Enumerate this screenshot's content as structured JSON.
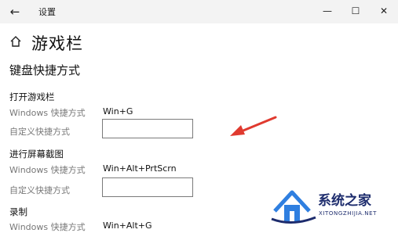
{
  "window": {
    "back_glyph": "←",
    "title": "设置",
    "minimize_glyph": "—",
    "maximize_glyph": "☐",
    "close_glyph": "✕"
  },
  "page": {
    "icon": "home-icon",
    "title": "游戏栏"
  },
  "section": {
    "title": "键盘快捷方式"
  },
  "groups": [
    {
      "heading": "打开游戏栏",
      "windows_label": "Windows 快捷方式",
      "windows_value": "Win+G",
      "custom_label": "自定义快捷方式",
      "custom_value": ""
    },
    {
      "heading": "进行屏幕截图",
      "windows_label": "Windows 快捷方式",
      "windows_value": "Win+Alt+PrtScrn",
      "custom_label": "自定义快捷方式",
      "custom_value": ""
    },
    {
      "heading": "录制",
      "windows_label": "Windows 快捷方式",
      "windows_value": "Win+Alt+G"
    }
  ],
  "annotation": {
    "arrow_color": "#e03a2f",
    "icon": "red-arrow-icon"
  },
  "watermark": {
    "brand": "系统之家",
    "url": "XITONGZHIJIA.NET",
    "logo_icon": "house-logo-icon"
  }
}
